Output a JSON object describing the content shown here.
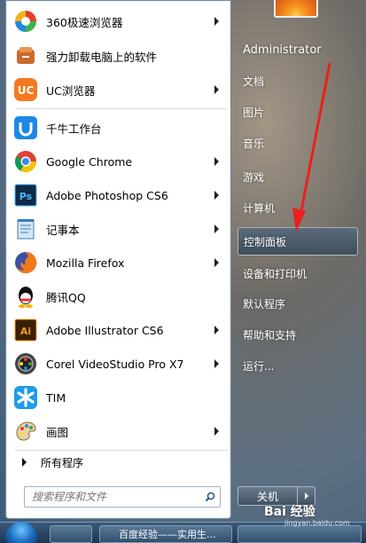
{
  "programs": [
    {
      "label": "360极速浏览器",
      "icon": "360-browser-icon",
      "submenu": true
    },
    {
      "label": "强力卸载电脑上的软件",
      "icon": "uninstaller-icon",
      "submenu": false
    },
    {
      "label": "UC浏览器",
      "icon": "uc-browser-icon",
      "submenu": true
    },
    {
      "label": "千牛工作台",
      "icon": "qianniu-icon",
      "submenu": false
    },
    {
      "label": "Google Chrome",
      "icon": "chrome-icon",
      "submenu": true
    },
    {
      "label": "Adobe Photoshop CS6",
      "icon": "photoshop-icon",
      "submenu": true
    },
    {
      "label": "记事本",
      "icon": "notepad-icon",
      "submenu": true
    },
    {
      "label": "Mozilla Firefox",
      "icon": "firefox-icon",
      "submenu": true
    },
    {
      "label": "腾讯QQ",
      "icon": "qq-icon",
      "submenu": false
    },
    {
      "label": "Adobe Illustrator CS6",
      "icon": "illustrator-icon",
      "submenu": true
    },
    {
      "label": "Corel VideoStudio Pro X7",
      "icon": "videostudio-icon",
      "submenu": true
    },
    {
      "label": "TIM",
      "icon": "tim-icon",
      "submenu": false
    },
    {
      "label": "画图",
      "icon": "paint-icon",
      "submenu": true
    }
  ],
  "all_programs": "所有程序",
  "search": {
    "placeholder": "搜索程序和文件"
  },
  "right_pane": {
    "user": "Administrator",
    "items": [
      "文档",
      "图片",
      "音乐",
      "游戏",
      "计算机",
      "控制面板",
      "设备和打印机",
      "默认程序",
      "帮助和支持",
      "运行..."
    ],
    "highlighted": "控制面板"
  },
  "shutdown": {
    "label": "关机"
  },
  "taskbar": {
    "window_title": "百度经验——实用生..."
  },
  "watermark": {
    "brand": "Bai 经验",
    "url": "jingyan.baidu.com"
  },
  "colors": {
    "annotation": "#e8211d",
    "menu_bg": "#ffffff"
  }
}
